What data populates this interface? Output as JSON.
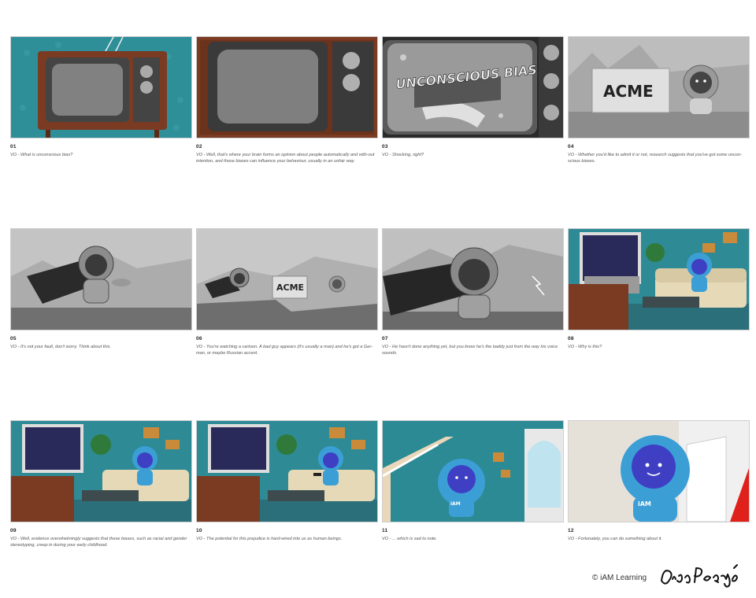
{
  "frames": [
    {
      "number": "01",
      "caption": "VO - What is unconscious bias?"
    },
    {
      "number": "02",
      "caption": "VO - Well, that's where your brain forms an opinion about people automatically and with-out intention, and those biases can influence your behaviour, usually in an unfair way."
    },
    {
      "number": "03",
      "caption": "VO - Shocking, right?",
      "title_card": "UNCONSCIOUS BIAS!"
    },
    {
      "number": "04",
      "caption": "VO - Whether you'd like to admit it or not, research suggests that you've got some uncon-scious biases.",
      "sign": "ACME"
    },
    {
      "number": "05",
      "caption": "VO - It's not your fault, don't worry. Think about this."
    },
    {
      "number": "06",
      "caption": "VO - You're watching a cartoon. A bad guy appears (it's usually a man) and he's got a Ger-man, or maybe Russian accent.",
      "sign": "ACME"
    },
    {
      "number": "07",
      "caption": "VO - He hasn't done anything yet, but you know he's the baddy just from the way his voice sounds."
    },
    {
      "number": "08",
      "caption": "VO - Why is this?"
    },
    {
      "number": "09",
      "caption": "VO - Well, evidence overwhelmingly suggests that these biases, such as racial and gender stereotyping, creep in during your early childhood."
    },
    {
      "number": "10",
      "caption": "VO - The potential for this prejudice is hard-wired into us as human beings."
    },
    {
      "number": "11",
      "caption": "VO - ... which is sad to note.",
      "badge": "iAM"
    },
    {
      "number": "12",
      "caption": "VO - Fortunately, you can do something about it.",
      "badge": "iAM"
    }
  ],
  "footer": {
    "copyright": "© iAM Learning",
    "signature": "DiegoPedanye"
  },
  "colors": {
    "teal_wall": "#2e8b95",
    "wood": "#7a3b22",
    "mascot_blue": "#3b9fd6",
    "mascot_face": "#3f3fc4",
    "sofa": "#e8dcc0",
    "gray_scene": "#9a9a9a"
  }
}
